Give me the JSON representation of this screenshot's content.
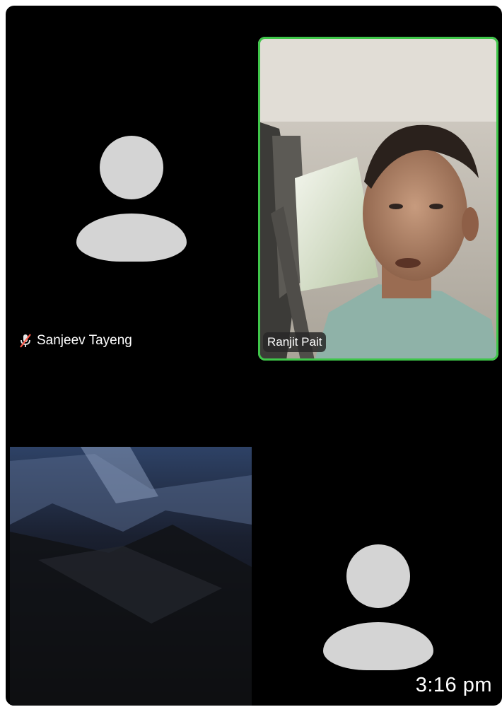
{
  "participants": {
    "sanjeev": {
      "name": "Sanjeev Tayeng",
      "muted": true
    },
    "ranjit": {
      "name": "Ranjit Pait",
      "active_speaker": true
    },
    "camera_tile": {
      "name": ""
    },
    "avatar_tile": {
      "name": ""
    }
  },
  "message": {
    "time": "3:16 pm"
  },
  "colors": {
    "background": "#000000",
    "avatar": "#d4d4d4",
    "active_speaker_border": "#3fc64a"
  }
}
